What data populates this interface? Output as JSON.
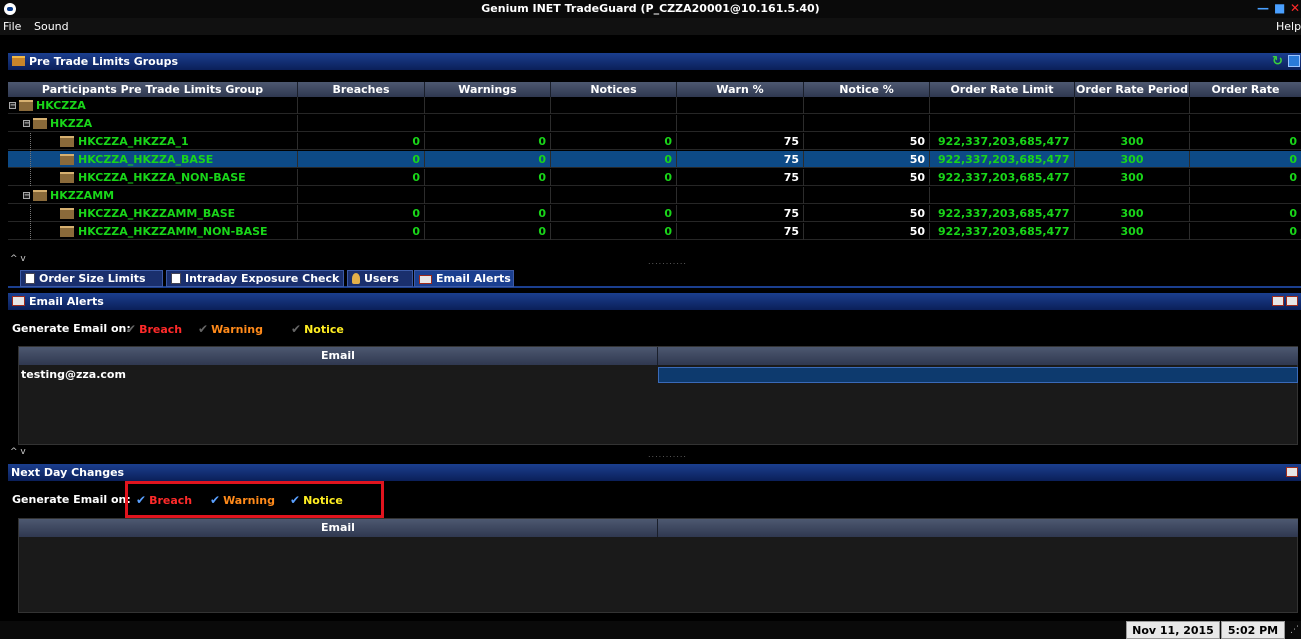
{
  "window": {
    "title": "Genium INET TradeGuard (P_CZZA20001@10.161.5.40)",
    "minimize": "—",
    "maximize": "■",
    "close": "✕"
  },
  "menu": {
    "file": "File",
    "sound": "Sound",
    "help": "Help"
  },
  "limits_section": {
    "title": "Pre Trade Limits Groups"
  },
  "grid": {
    "columns": [
      "Participants Pre Trade Limits Group",
      "Breaches",
      "Warnings",
      "Notices",
      "Warn %",
      "Notice %",
      "Order Rate Limit",
      "Order Rate Period",
      "Order Rate"
    ],
    "rows": [
      {
        "name": "HKCZZA",
        "level": 0,
        "values": [
          "",
          "",
          "",
          "",
          "",
          "",
          "",
          ""
        ]
      },
      {
        "name": "HKZZA",
        "level": 1,
        "values": [
          "",
          "",
          "",
          "",
          "",
          "",
          "",
          ""
        ]
      },
      {
        "name": "HKCZZA_HKZZA_1",
        "level": 2,
        "values": [
          "0",
          "0",
          "0",
          "75",
          "50",
          "922,337,203,685,477",
          "300",
          "0"
        ]
      },
      {
        "name": "HKCZZA_HKZZA_BASE",
        "level": 2,
        "selected": true,
        "values": [
          "0",
          "0",
          "0",
          "75",
          "50",
          "922,337,203,685,477",
          "300",
          "0"
        ]
      },
      {
        "name": "HKCZZA_HKZZA_NON-BASE",
        "level": 2,
        "values": [
          "0",
          "0",
          "0",
          "75",
          "50",
          "922,337,203,685,477",
          "300",
          "0"
        ]
      },
      {
        "name": "HKZZAMM",
        "level": 1,
        "values": [
          "",
          "",
          "",
          "",
          "",
          "",
          "",
          ""
        ]
      },
      {
        "name": "HKCZZA_HKZZAMM_BASE",
        "level": 2,
        "values": [
          "0",
          "0",
          "0",
          "75",
          "50",
          "922,337,203,685,477",
          "300",
          "0"
        ]
      },
      {
        "name": "HKCZZA_HKZZAMM_NON-BASE",
        "level": 2,
        "values": [
          "0",
          "0",
          "0",
          "75",
          "50",
          "922,337,203,685,477",
          "300",
          "0"
        ]
      }
    ]
  },
  "tabs": {
    "order_size": "Order Size Limits",
    "intraday": "Intraday Exposure Check",
    "users": "Users",
    "email_alerts": "Email Alerts"
  },
  "email_section": {
    "title": "Email Alerts",
    "generate_label": "Generate Email on:",
    "breach": "Breach",
    "warning": "Warning",
    "notice": "Notice",
    "column": "Email",
    "row_email": "testing@zza.com"
  },
  "next_day_section": {
    "title": "Next Day Changes",
    "generate_label": "Generate Email on:",
    "breach": "Breach",
    "warning": "Warning",
    "notice": "Notice",
    "column": "Email"
  },
  "status": {
    "date": "Nov 11, 2015",
    "time": "5:02 PM"
  },
  "colors": {
    "accent": "#1b3f8f",
    "green_text": "#19d619",
    "selected_row": "#0d4a86",
    "highlight_box": "#e0141e"
  }
}
